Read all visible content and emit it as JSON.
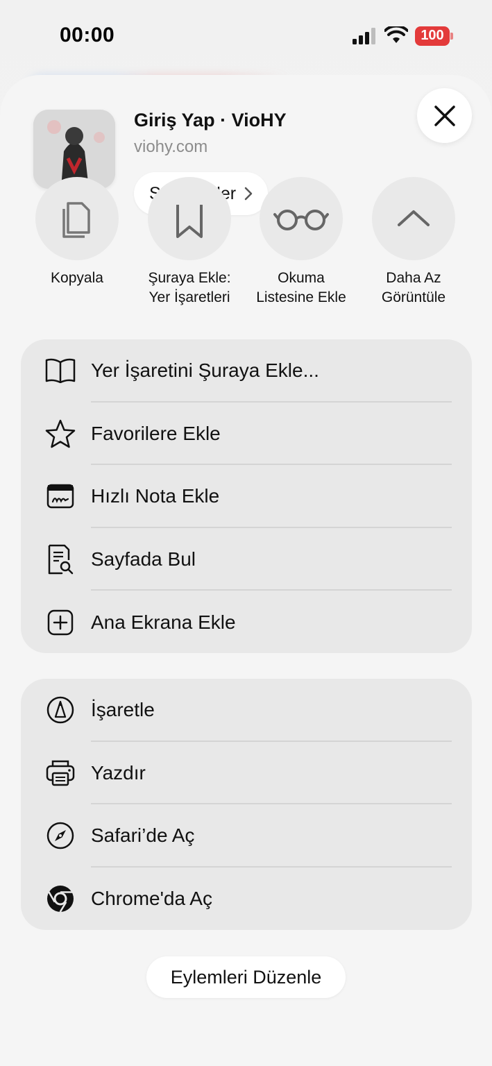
{
  "status_bar": {
    "time": "00:00",
    "battery": "100",
    "battery_color": "#e33a3a",
    "icons": [
      "cellular-signal-icon",
      "wifi-icon",
      "battery-icon"
    ]
  },
  "header": {
    "title": "Giriş Yap · VioHY",
    "url": "viohy.com",
    "options_label": "Seçenekler",
    "close_icon": "close-icon"
  },
  "quick_actions": [
    {
      "label": "Kopyala",
      "icon": "copy-icon"
    },
    {
      "label": "Şuraya Ekle:\nYer İşaretleri",
      "icon": "bookmark-icon"
    },
    {
      "label": "Okuma\nListesine Ekle",
      "icon": "reading-glasses-icon"
    },
    {
      "label": "Daha Az\nGörüntüle",
      "icon": "chevron-up-icon"
    }
  ],
  "menu_group_1": [
    {
      "label": "Yer İşaretini Şuraya Ekle...",
      "icon": "book-icon"
    },
    {
      "label": "Favorilere Ekle",
      "icon": "star-icon"
    },
    {
      "label": "Hızlı Nota Ekle",
      "icon": "quick-note-icon"
    },
    {
      "label": "Sayfada Bul",
      "icon": "find-in-page-icon"
    },
    {
      "label": "Ana Ekrana Ekle",
      "icon": "add-square-icon"
    }
  ],
  "menu_group_2": [
    {
      "label": "İşaretle",
      "icon": "markup-icon"
    },
    {
      "label": "Yazdır",
      "icon": "printer-icon"
    },
    {
      "label": "Safari’de Aç",
      "icon": "compass-icon"
    },
    {
      "label": "Chrome'da Aç",
      "icon": "chrome-icon"
    }
  ],
  "footer": {
    "edit_actions_label": "Eylemleri Düzenle"
  }
}
